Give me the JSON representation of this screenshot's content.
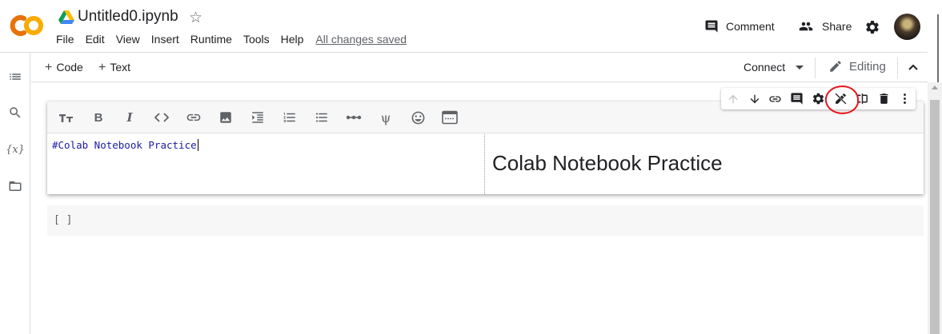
{
  "header": {
    "notebook_title": "Untitled0.ipynb",
    "menu": [
      "File",
      "Edit",
      "View",
      "Insert",
      "Runtime",
      "Tools",
      "Help"
    ],
    "save_status": "All changes saved",
    "comment_label": "Comment",
    "share_label": "Share",
    "logo_icon": "colab-logo",
    "colors": {
      "logo_orange": "#f9ab00",
      "logo_dark_orange": "#e8710a"
    }
  },
  "sidebar": {
    "icons": [
      "table-of-contents-icon",
      "search-icon",
      "variables-icon",
      "files-icon"
    ],
    "variables_glyph": "{x}"
  },
  "toolbar": {
    "add_code_label": "Code",
    "add_text_label": "Text",
    "connect_label": "Connect",
    "editing_label": "Editing"
  },
  "text_cell": {
    "format_buttons": [
      "heading",
      "bold",
      "italic",
      "code",
      "link",
      "image",
      "indent",
      "numbered-list",
      "bulleted-list",
      "horizontal-rule",
      "latex",
      "emoji",
      "preview-mode"
    ],
    "bold_glyph": "B",
    "italic_glyph": "I",
    "psi_glyph": "ψ",
    "editor_text": "#Colab Notebook Practice",
    "preview_heading": "Colab Notebook Practice"
  },
  "cell_actions": {
    "buttons": [
      "move-up",
      "move-down",
      "link",
      "comment",
      "settings",
      "edit-mode",
      "mirror-cell",
      "delete",
      "more"
    ],
    "highlighted": "edit-mode",
    "highlight_color": "#e8141a"
  },
  "code_cell": {
    "run_indicator": "[ ]"
  }
}
